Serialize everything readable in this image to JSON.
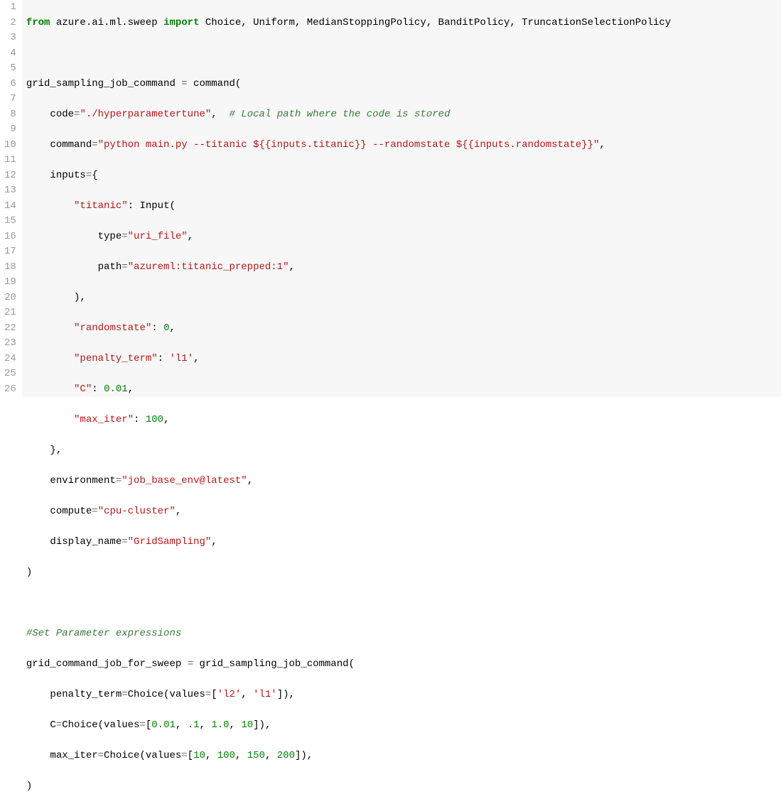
{
  "gutter": [
    "1",
    "2",
    "3",
    "4",
    "5",
    "6",
    "7",
    "8",
    "9",
    "10",
    "11",
    "12",
    "13",
    "14",
    "15",
    "16",
    "17",
    "18",
    "19",
    "20",
    "21",
    "22",
    "23",
    "24",
    "25",
    "26"
  ],
  "code": {
    "l1": {
      "from": "from",
      "mod": " azure.ai.ml.sweep ",
      "import": "import",
      "rest": " Choice, Uniform, MedianStoppingPolicy, BanditPolicy, TruncationSelectionPolicy"
    },
    "l2": "",
    "l3": {
      "a": "grid_sampling_job_command ",
      "eq": "=",
      "b": " command("
    },
    "l4": {
      "a": "    code",
      "eq": "=",
      "s": "\"./hyperparametertune\"",
      "c": ",  ",
      "com": "# Local path where the code is stored"
    },
    "l5": {
      "a": "    command",
      "eq": "=",
      "s": "\"python main.py --titanic ${{inputs.titanic}} --randomstate ${{inputs.randomstate}}\"",
      "c": ","
    },
    "l6": {
      "a": "    inputs",
      "eq": "=",
      "b": "{"
    },
    "l7": {
      "a": "        ",
      "s": "\"titanic\"",
      "b": ": Input("
    },
    "l8": {
      "a": "            type",
      "eq": "=",
      "s": "\"uri_file\"",
      "c": ","
    },
    "l9": {
      "a": "            path",
      "eq": "=",
      "s": "\"azureml:titanic_prepped:1\"",
      "c": ","
    },
    "l10": "        ),",
    "l11": {
      "a": "        ",
      "s": "\"randomstate\"",
      "b": ": ",
      "n": "0",
      "c": ","
    },
    "l12": {
      "a": "        ",
      "s": "\"penalty_term\"",
      "b": ": ",
      "s2": "'l1'",
      "c": ","
    },
    "l13": {
      "a": "        ",
      "s": "\"C\"",
      "b": ": ",
      "n": "0.01",
      "c": ","
    },
    "l14": {
      "a": "        ",
      "s": "\"max_iter\"",
      "b": ": ",
      "n": "100",
      "c": ","
    },
    "l15": "    },",
    "l16": {
      "a": "    environment",
      "eq": "=",
      "s": "\"job_base_env@latest\"",
      "c": ","
    },
    "l17": {
      "a": "    compute",
      "eq": "=",
      "s": "\"cpu-cluster\"",
      "c": ","
    },
    "l18": {
      "a": "    display_name",
      "eq": "=",
      "s": "\"GridSampling\"",
      "c": ","
    },
    "l19": ")",
    "l20": "",
    "l21": {
      "com": "#Set Parameter expressions"
    },
    "l22": {
      "a": "grid_command_job_for_sweep ",
      "eq": "=",
      "b": " grid_sampling_job_command("
    },
    "l23": {
      "a": "    penalty_term",
      "eq": "=",
      "b": "Choice(values",
      "eq2": "=",
      "br": "[",
      "s1": "'l2'",
      "c1": ", ",
      "s2": "'l1'",
      "end": "]),"
    },
    "l24": {
      "a": "    C",
      "eq": "=",
      "b": "Choice(values",
      "eq2": "=",
      "br": "[",
      "n1": "0.01",
      "c1": ", ",
      "n2": ".1",
      "c2": ", ",
      "n3": "1.0",
      "c3": ", ",
      "n4": "10",
      "end": "]),"
    },
    "l25": {
      "a": "    max_iter",
      "eq": "=",
      "b": "Choice(values",
      "eq2": "=",
      "br": "[",
      "n1": "10",
      "c1": ", ",
      "n2": "100",
      "c2": ", ",
      "n3": "150",
      "c3": ", ",
      "n4": "200",
      "end": "]),"
    },
    "l26": ")"
  }
}
